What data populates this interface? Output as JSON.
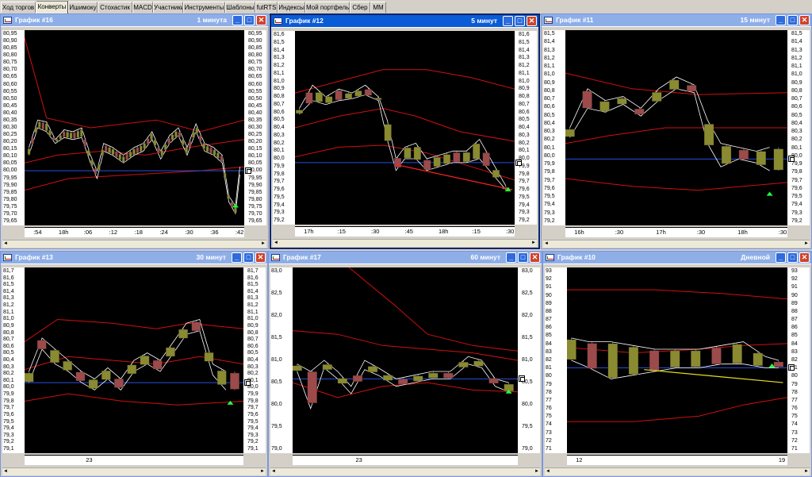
{
  "tabs": [
    "Ход торгов",
    "Конверты",
    "Ишимоку",
    "Стохастик",
    "MACD",
    "Участники",
    "Инструменты",
    "Шаблоны",
    "futRTS",
    "Индексы",
    "Мой портфель",
    "Сбер",
    "MM"
  ],
  "active_tab": 1,
  "colors": {
    "plot_bg": "#000000",
    "envelope": "#d01010",
    "price_line": "#ffffff",
    "baseline": "#2850e0",
    "candle_up": "#8a8a30",
    "candle_down": "#9c4a4a",
    "trend_line": "#ff2020",
    "trend_line_daily": "#e8e020",
    "arrow": "#20ff40"
  },
  "windows": [
    {
      "title": "График #16",
      "timeframe": "1 минута",
      "yticks": [
        "80,95",
        "80,90",
        "80,85",
        "80,80",
        "80,75",
        "80,70",
        "80,65",
        "80,60",
        "80,55",
        "80,50",
        "80,45",
        "80,40",
        "80,35",
        "80,30",
        "80,25",
        "80,20",
        "80,15",
        "80,10",
        "80,05",
        "80,00",
        "79,95",
        "79,90",
        "79,85",
        "79,80",
        "79,75",
        "79,70",
        "79,65"
      ],
      "xlabels": [
        ":54",
        "18h",
        ":06",
        ":12",
        ":18",
        ":24",
        ":30",
        ":36",
        ":42"
      ],
      "marker": "80,00"
    },
    {
      "title": "График #12",
      "timeframe": "5 минут",
      "yticks": [
        "81,6",
        "81,5",
        "81,4",
        "81,3",
        "81,2",
        "81,1",
        "81,0",
        "80,9",
        "80,8",
        "80,7",
        "80,6",
        "80,5",
        "80,4",
        "80,3",
        "80,2",
        "80,1",
        "80,0",
        "79,9",
        "79,8",
        "79,7",
        "79,6",
        "79,5",
        "79,4",
        "79,3",
        "79,2"
      ],
      "xlabels": [
        "17h",
        ":15",
        ":30",
        ":45",
        "18h",
        ":15",
        ":30"
      ],
      "marker": "80,0"
    },
    {
      "title": "График #11",
      "timeframe": "15 минут",
      "yticks": [
        "81,5",
        "81,4",
        "81,3",
        "81,2",
        "81,1",
        "81,0",
        "80,9",
        "80,8",
        "80,7",
        "80,6",
        "80,5",
        "80,4",
        "80,3",
        "80,2",
        "80,1",
        "80,0",
        "79,9",
        "79,8",
        "79,7",
        "79,6",
        "79,5",
        "79,4",
        "79,3",
        "79,2"
      ],
      "xlabels": [
        "16h",
        ":30",
        "17h",
        ":30",
        "18h",
        ":30"
      ],
      "marker": "80,0"
    },
    {
      "title": "График #13",
      "timeframe": "30 минут",
      "yticks": [
        "81,7",
        "81,6",
        "81,5",
        "81,4",
        "81,3",
        "81,2",
        "81,1",
        "81,0",
        "80,9",
        "80,8",
        "80,7",
        "80,6",
        "80,5",
        "80,4",
        "80,3",
        "80,2",
        "80,1",
        "80,0",
        "79,9",
        "79,8",
        "79,7",
        "79,6",
        "79,5",
        "79,4",
        "79,3",
        "79,2",
        "79,1"
      ],
      "xlabels": [
        "23"
      ],
      "marker": "80,0"
    },
    {
      "title": "График #17",
      "timeframe": "60 минут",
      "yticks": [
        "83,0",
        "82,5",
        "82,0",
        "81,5",
        "81,0",
        "80,5",
        "80,0",
        "79,5",
        "79,0"
      ],
      "xlabels": [
        "23"
      ],
      "marker": "80,0"
    },
    {
      "title": "График #10",
      "timeframe": "Дневной",
      "yticks": [
        "93",
        "92",
        "91",
        "90",
        "89",
        "88",
        "87",
        "86",
        "85",
        "84",
        "83",
        "82",
        "81",
        "80",
        "79",
        "78",
        "77",
        "76",
        "75",
        "74",
        "73",
        "72",
        "71"
      ],
      "xlabels": [
        "12",
        "19"
      ],
      "marker": "80"
    }
  ]
}
